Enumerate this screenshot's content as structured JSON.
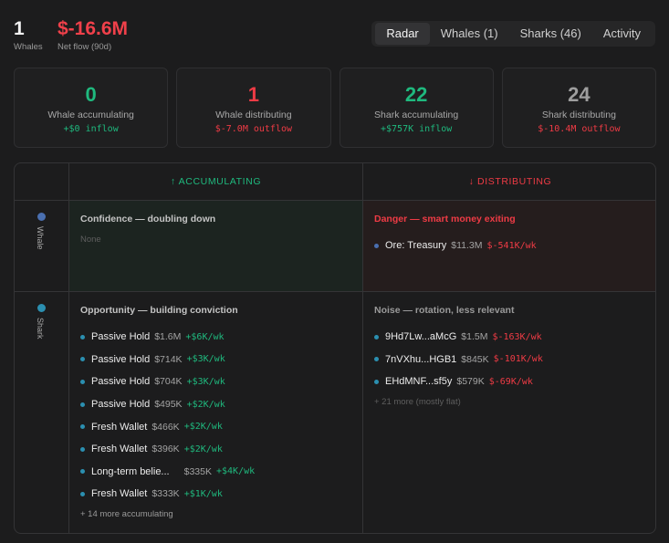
{
  "summary": {
    "whales_count": "1",
    "whales_label": "Whales",
    "net_flow": "$-16.6M",
    "net_flow_label": "Net flow (90d)"
  },
  "tabs": [
    {
      "label": "Radar",
      "active": true
    },
    {
      "label": "Whales (1)",
      "active": false
    },
    {
      "label": "Sharks (46)",
      "active": false
    },
    {
      "label": "Activity",
      "active": false
    }
  ],
  "cards": [
    {
      "value": "0",
      "title": "Whale accumulating",
      "sub": "+$0 inflow",
      "color": "#1fb97e"
    },
    {
      "value": "1",
      "title": "Whale distributing",
      "sub": "$-7.0M outflow",
      "color": "#ef3b45"
    },
    {
      "value": "22",
      "title": "Shark accumulating",
      "sub": "+$757K inflow",
      "color": "#1fb97e"
    },
    {
      "value": "24",
      "title": "Shark distributing",
      "sub": "$-10.4M outflow",
      "color": "#ef3b45"
    }
  ],
  "grid": {
    "col_accumulating": "↑ ACCUMULATING",
    "col_distributing": "↓ DISTRIBUTING",
    "row_whale": "Whale",
    "row_shark": "Shark",
    "whale_accumulating": {
      "title": "Confidence — doubling down",
      "empty": "None"
    },
    "whale_distributing": {
      "title": "Danger — smart money exiting",
      "items": [
        {
          "name": "Ore: Treasury",
          "amount": "$11.3M",
          "flow": "$-541K/wk"
        }
      ]
    },
    "shark_accumulating": {
      "title": "Opportunity — building conviction",
      "items": [
        {
          "name": "Passive Hold",
          "amount": "$1.6M",
          "flow": "+$6K/wk"
        },
        {
          "name": "Passive Hold",
          "amount": "$714K",
          "flow": "+$3K/wk"
        },
        {
          "name": "Passive Hold",
          "amount": "$704K",
          "flow": "+$3K/wk"
        },
        {
          "name": "Passive Hold",
          "amount": "$495K",
          "flow": "+$2K/wk"
        },
        {
          "name": "Fresh Wallet",
          "amount": "$466K",
          "flow": "+$2K/wk"
        },
        {
          "name": "Fresh Wallet",
          "amount": "$396K",
          "flow": "+$2K/wk"
        },
        {
          "name": "Long-term belie...",
          "amount": "$335K",
          "flow": "+$4K/wk"
        },
        {
          "name": "Fresh Wallet",
          "amount": "$333K",
          "flow": "+$1K/wk"
        }
      ],
      "more": "+ 14 more accumulating"
    },
    "shark_distributing": {
      "title": "Noise — rotation, less relevant",
      "items": [
        {
          "name": "9Hd7Lw...aMcG",
          "amount": "$1.5M",
          "flow": "$-163K/wk"
        },
        {
          "name": "7nVXhu...HGB1",
          "amount": "$845K",
          "flow": "$-101K/wk"
        },
        {
          "name": "EHdMNF...sf5y",
          "amount": "$579K",
          "flow": "$-69K/wk"
        }
      ],
      "more": "+ 21 more (mostly flat)"
    }
  },
  "colors": {
    "accent_green": "#1fb97e",
    "accent_red": "#ef3b45",
    "whale_dot": "#4a6fb0",
    "shark_dot": "#2b8fb0"
  }
}
